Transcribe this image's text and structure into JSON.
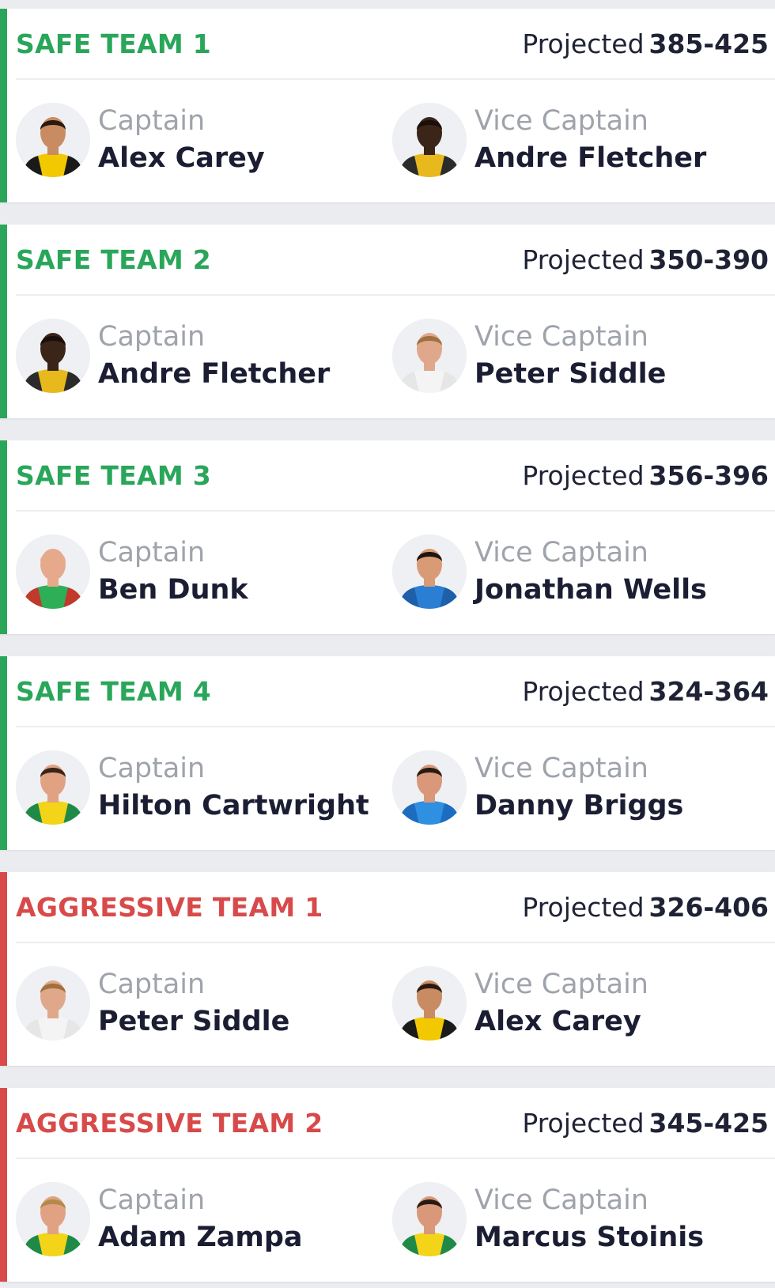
{
  "colors": {
    "safe": "#2aa65a",
    "aggressive": "#d84a4a",
    "text_dark": "#1b1e33",
    "text_muted": "#9fa3ab"
  },
  "teams": [
    {
      "type": "safe",
      "name": "SAFE TEAM 1",
      "projected_label": "Projected",
      "projected_range": "385-425",
      "captain": {
        "role": "Captain",
        "name": "Alex Carey",
        "jersey": "#f2c800",
        "shirt_dark": "#1a1a1a",
        "skin": "#c98b62",
        "hair": "#2a1a12"
      },
      "vice_captain": {
        "role": "Vice Captain",
        "name": "Andre Fletcher",
        "jersey": "#e8b91c",
        "shirt_dark": "#2b2b2b",
        "skin": "#3b2418",
        "hair": "#1a0f0a"
      }
    },
    {
      "type": "safe",
      "name": "SAFE TEAM 2",
      "projected_label": "Projected",
      "projected_range": "350-390",
      "captain": {
        "role": "Captain",
        "name": "Andre Fletcher",
        "jersey": "#e8b91c",
        "shirt_dark": "#2b2b2b",
        "skin": "#3b2418",
        "hair": "#1a0f0a"
      },
      "vice_captain": {
        "role": "Vice Captain",
        "name": "Peter Siddle",
        "jersey": "#f4f4f4",
        "shirt_dark": "#e6e6e6",
        "skin": "#e0a88a",
        "hair": "#a07040"
      }
    },
    {
      "type": "safe",
      "name": "SAFE TEAM 3",
      "projected_label": "Projected",
      "projected_range": "356-396",
      "captain": {
        "role": "Captain",
        "name": "Ben Dunk",
        "jersey": "#2fae58",
        "shirt_dark": "#c0392b",
        "skin": "#e6a98b",
        "hair": "#e6a98b"
      },
      "vice_captain": {
        "role": "Vice Captain",
        "name": "Jonathan Wells",
        "jersey": "#2a7fd4",
        "shirt_dark": "#1d5fa8",
        "skin": "#d99a76",
        "hair": "#1e1410"
      }
    },
    {
      "type": "safe",
      "name": "SAFE TEAM 4",
      "projected_label": "Projected",
      "projected_range": "324-364",
      "captain": {
        "role": "Captain",
        "name": "Hilton Cartwright",
        "jersey": "#f3d419",
        "shirt_dark": "#1f8a48",
        "skin": "#e0a283",
        "hair": "#3a2618"
      },
      "vice_captain": {
        "role": "Vice Captain",
        "name": "Danny Briggs",
        "jersey": "#2f8fe0",
        "shirt_dark": "#1c6cc0",
        "skin": "#d9987a",
        "hair": "#2a1b12"
      }
    },
    {
      "type": "aggressive",
      "name": "AGGRESSIVE TEAM 1",
      "projected_label": "Projected",
      "projected_range": "326-406",
      "captain": {
        "role": "Captain",
        "name": "Peter Siddle",
        "jersey": "#f4f4f4",
        "shirt_dark": "#e6e6e6",
        "skin": "#e0a88a",
        "hair": "#a07040"
      },
      "vice_captain": {
        "role": "Vice Captain",
        "name": "Alex Carey",
        "jersey": "#f2c800",
        "shirt_dark": "#1a1a1a",
        "skin": "#c98b62",
        "hair": "#2a1a12"
      }
    },
    {
      "type": "aggressive",
      "name": "AGGRESSIVE TEAM 2",
      "projected_label": "Projected",
      "projected_range": "345-425",
      "captain": {
        "role": "Captain",
        "name": "Adam Zampa",
        "jersey": "#f3d419",
        "shirt_dark": "#1f8a48",
        "skin": "#e0a283",
        "hair": "#b48a4a"
      },
      "vice_captain": {
        "role": "Vice Captain",
        "name": "Marcus Stoinis",
        "jersey": "#f3d419",
        "shirt_dark": "#1f8a48",
        "skin": "#d9987a",
        "hair": "#2a1b12"
      }
    }
  ]
}
